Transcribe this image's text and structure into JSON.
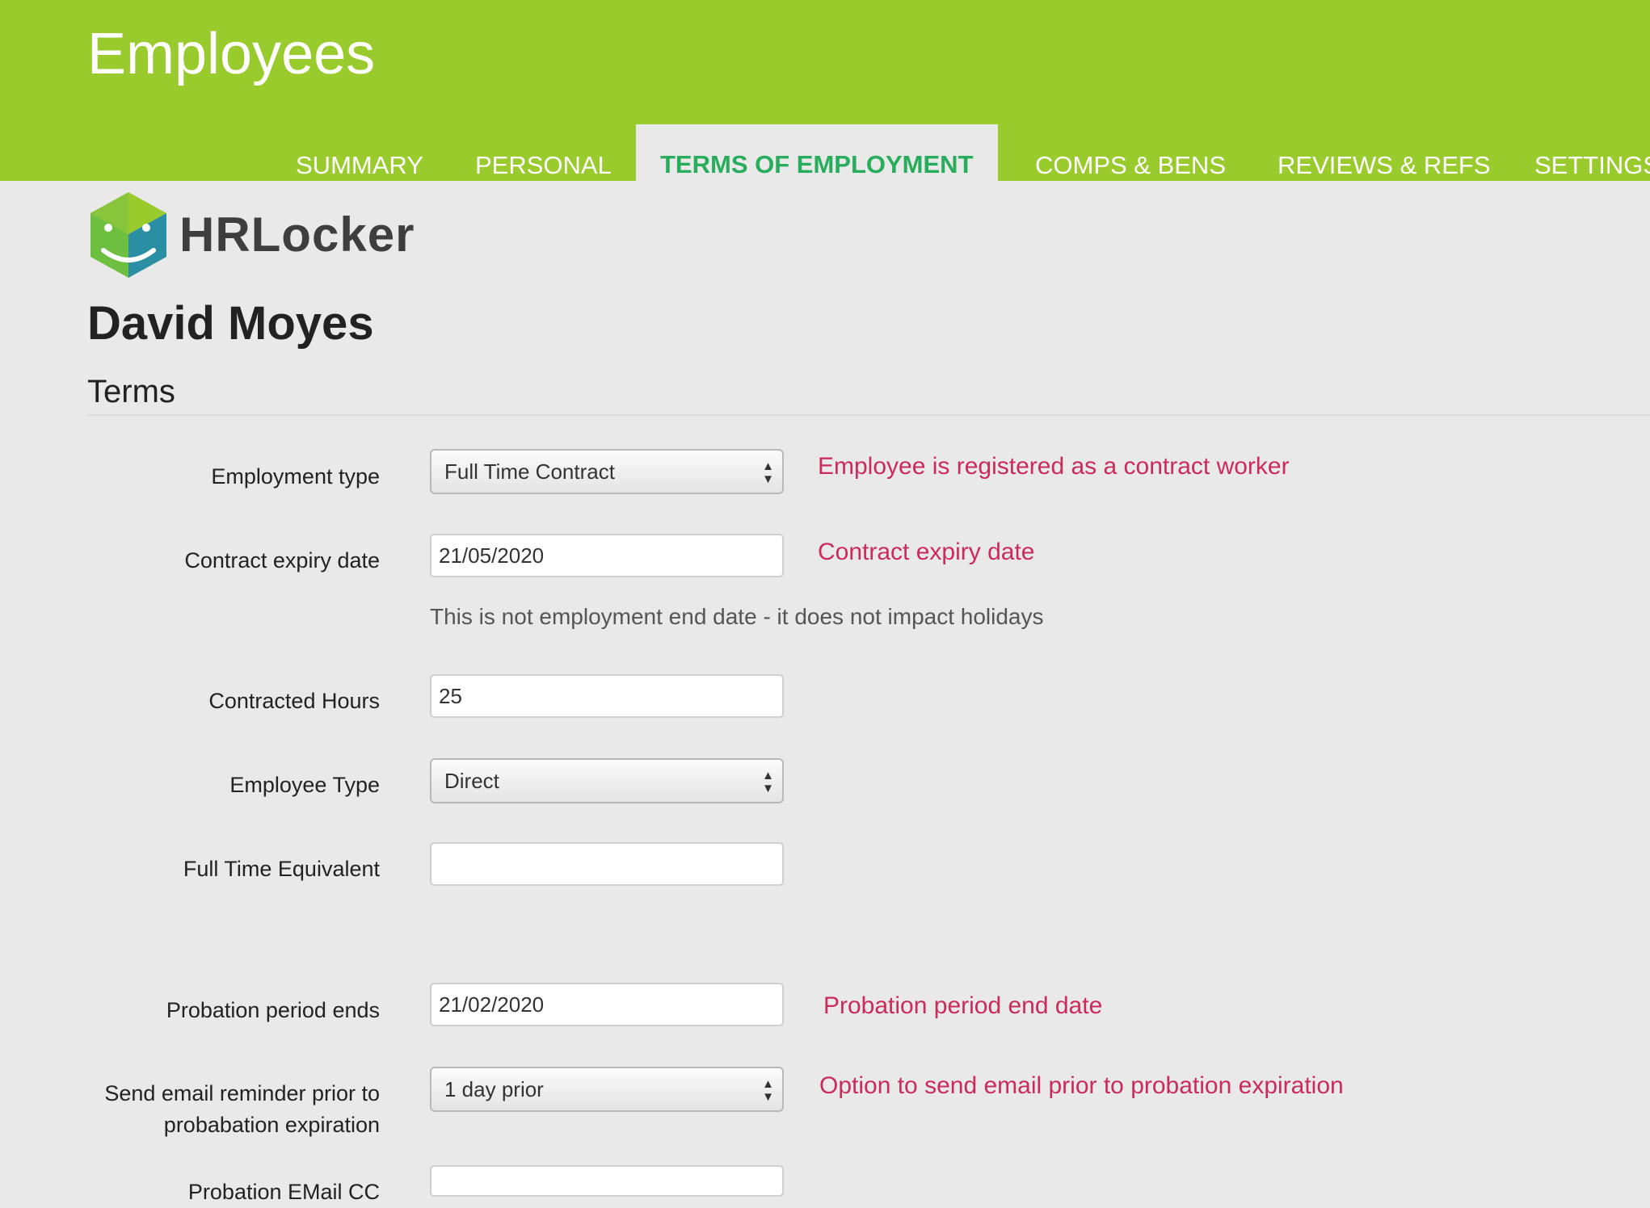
{
  "header": {
    "title": "Employees",
    "tabs": [
      {
        "label": "SUMMARY"
      },
      {
        "label": "PERSONAL"
      },
      {
        "label": "TERMS OF EMPLOYMENT"
      },
      {
        "label": "COMPS & BENS"
      },
      {
        "label": "REVIEWS & REFS"
      },
      {
        "label": "SETTINGS"
      }
    ],
    "active_tab": "TERMS OF EMPLOYMENT"
  },
  "brand": {
    "name": "HRLocker"
  },
  "employee": {
    "name": "David Moyes"
  },
  "section": {
    "title": "Terms"
  },
  "form": {
    "employment_type": {
      "label": "Employment type",
      "value": "Full Time Contract",
      "hint": "Employee is registered as a contract worker"
    },
    "contract_expiry": {
      "label": "Contract expiry date",
      "value": "21/05/2020",
      "hint": "Contract expiry date",
      "help": "This is not employment end date - it does not impact holidays"
    },
    "contracted_hours": {
      "label": "Contracted Hours",
      "value": "25"
    },
    "employee_type": {
      "label": "Employee Type",
      "value": "Direct"
    },
    "fte": {
      "label": "Full Time Equivalent",
      "value": ""
    },
    "probation_end": {
      "label": "Probation period ends",
      "value": "21/02/2020",
      "hint": "Probation period end date"
    },
    "email_reminder": {
      "label_line1": "Send email reminder prior to",
      "label_line2": "probabation expiration",
      "value": "1 day prior",
      "hint": "Option to send email prior to probation expiration"
    },
    "probation_email_cc": {
      "label": "Probation EMail CC",
      "value": ""
    }
  },
  "colors": {
    "header_bg": "#9acb2d",
    "active_tab_text": "#27ad5c",
    "hint_text": "#cb2b5a",
    "page_bg": "#e9e9e9"
  }
}
